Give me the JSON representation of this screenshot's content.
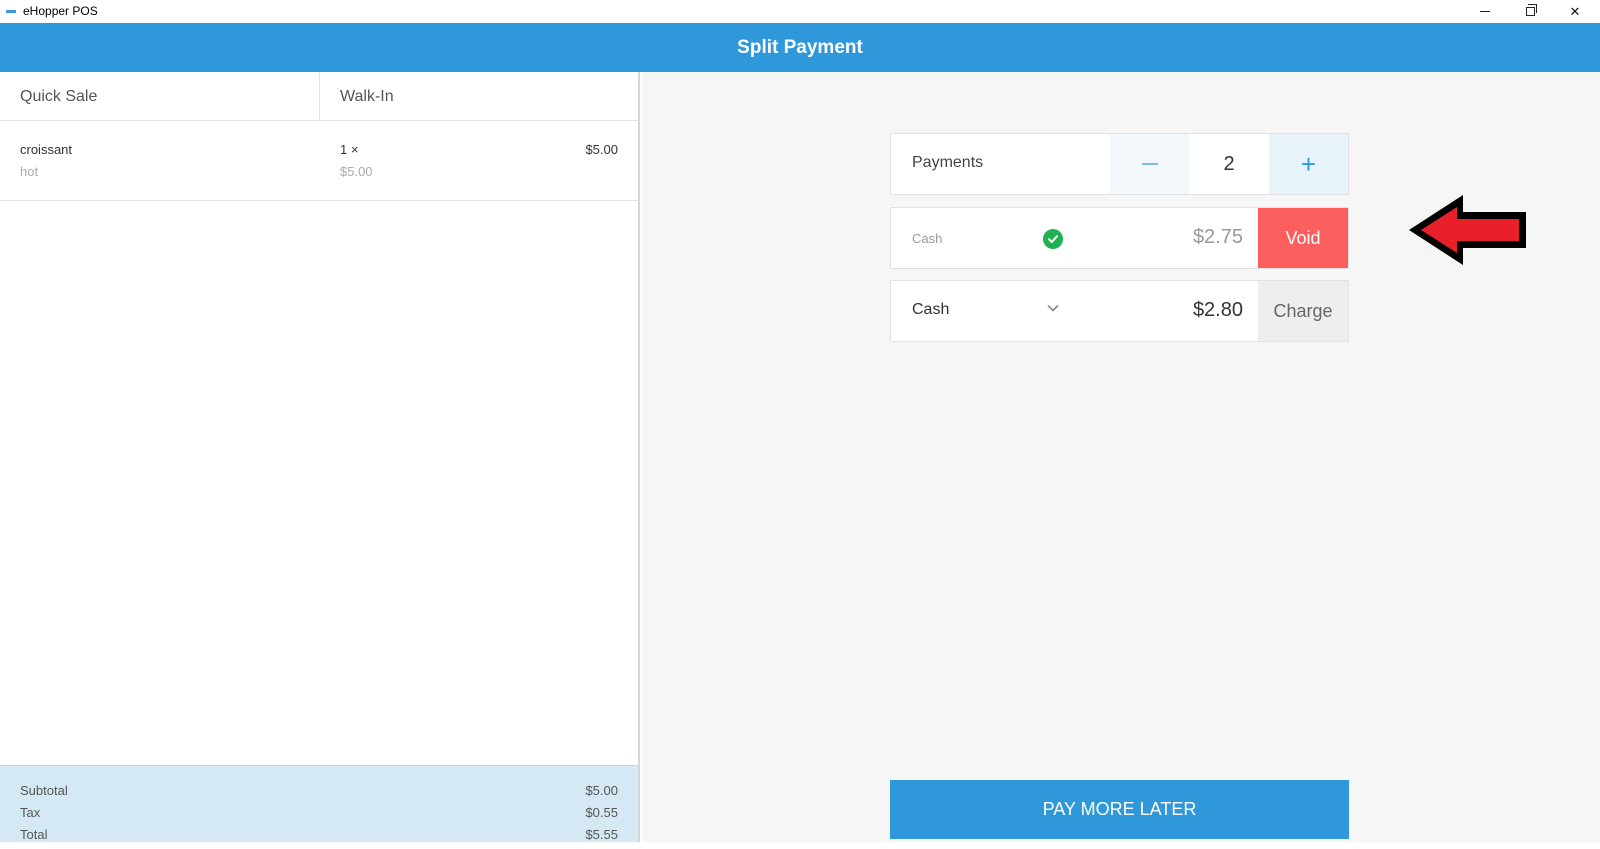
{
  "window": {
    "app_title": "eHopper POS"
  },
  "header": {
    "title": "Split Payment"
  },
  "order": {
    "tabs": [
      "Quick Sale",
      "Walk-In"
    ],
    "items": [
      {
        "name": "croissant",
        "modifier": "hot",
        "quantity": "1 ×",
        "unit_price": "$5.00",
        "total": "$5.00"
      }
    ],
    "totals": {
      "subtotal_label": "Subtotal",
      "subtotal_value": "$5.00",
      "tax_label": "Tax",
      "tax_value": "$0.55",
      "total_label": "Total",
      "total_value": "$5.55"
    }
  },
  "split": {
    "payments_label": "Payments",
    "payments_count": "2",
    "paid": {
      "method": "Cash",
      "amount": "$2.75",
      "action": "Void"
    },
    "due": {
      "method": "Cash",
      "amount": "$2.80",
      "action": "Charge"
    },
    "pay_later_label": "PAY MORE LATER"
  },
  "colors": {
    "header": "#2f98da",
    "void": "#fd5f5f",
    "check": "#1fb14f",
    "annotation_arrow": "#e8202a"
  },
  "icons": [
    "minimize-icon",
    "maximize-icon",
    "close-icon",
    "minus-icon",
    "plus-icon",
    "check-icon",
    "chevron-down-icon",
    "arrow-annotation"
  ]
}
